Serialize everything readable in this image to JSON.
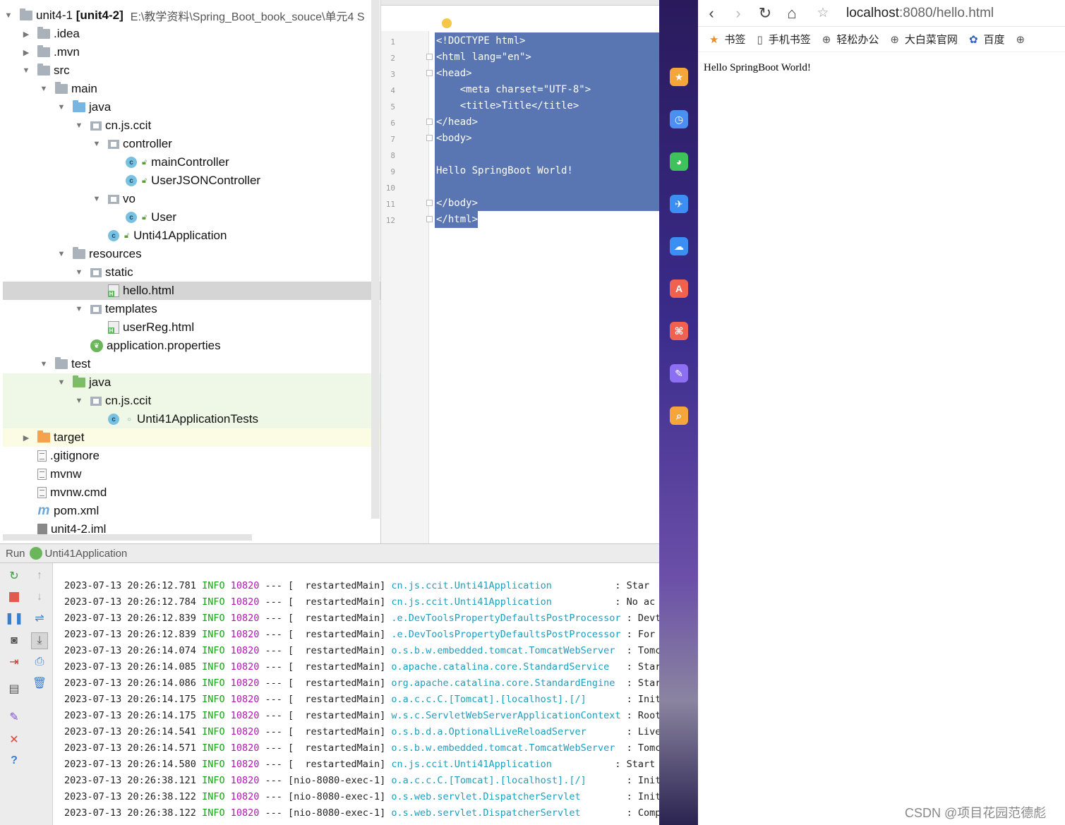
{
  "project": {
    "items": [
      {
        "label": "unit4-1",
        "bold": "[unit4-2]",
        "path": "E:\\教学资料\\Spring_Boot_book_souce\\单元4 S"
      },
      {
        "label": ".idea"
      },
      {
        "label": ".mvn"
      },
      {
        "label": "src"
      },
      {
        "label": "main"
      },
      {
        "label": "java"
      },
      {
        "label": "cn.js.ccit"
      },
      {
        "label": "controller"
      },
      {
        "label": "mainController"
      },
      {
        "label": "UserJSONController"
      },
      {
        "label": "vo"
      },
      {
        "label": "User"
      },
      {
        "label": "Unti41Application"
      },
      {
        "label": "resources"
      },
      {
        "label": "static"
      },
      {
        "label": "hello.html"
      },
      {
        "label": "templates"
      },
      {
        "label": "userReg.html"
      },
      {
        "label": "application.properties"
      },
      {
        "label": "test"
      },
      {
        "label": "java"
      },
      {
        "label": "cn.js.ccit"
      },
      {
        "label": "Unti41ApplicationTests"
      },
      {
        "label": "target"
      },
      {
        "label": ".gitignore"
      },
      {
        "label": "mvnw"
      },
      {
        "label": "mvnw.cmd"
      },
      {
        "label": "pom.xml"
      },
      {
        "label": "unit4-2.iml"
      }
    ]
  },
  "editor": {
    "lines": [
      {
        "n": "1",
        "text": "<!DOCTYPE html>"
      },
      {
        "n": "2",
        "text": "<html lang=\"en\">"
      },
      {
        "n": "3",
        "text": "<head>"
      },
      {
        "n": "4",
        "text": "    <meta charset=\"UTF-8\">"
      },
      {
        "n": "5",
        "text": "    <title>Title</title>"
      },
      {
        "n": "6",
        "text": "</head>"
      },
      {
        "n": "7",
        "text": "<body>"
      },
      {
        "n": "8",
        "text": ""
      },
      {
        "n": "9",
        "text": "Hello SpringBoot World!"
      },
      {
        "n": "10",
        "text": ""
      },
      {
        "n": "11",
        "text": "</body>"
      },
      {
        "n": "12",
        "text": "</html>"
      }
    ]
  },
  "run": {
    "tab_label": "Run",
    "app_name": "Unti41Application",
    "logs": [
      {
        "ts": "2023-07-13 20:26:12.781",
        "level": "INFO",
        "pid": "10820",
        "sep": "---",
        "thread": "[  restartedMain]",
        "logger": "cn.js.ccit.Unti41Application          ",
        "msg": ": Star"
      },
      {
        "ts": "2023-07-13 20:26:12.784",
        "level": "INFO",
        "pid": "10820",
        "sep": "---",
        "thread": "[  restartedMain]",
        "logger": "cn.js.ccit.Unti41Application          ",
        "msg": ": No ac"
      },
      {
        "ts": "2023-07-13 20:26:12.839",
        "level": "INFO",
        "pid": "10820",
        "sep": "---",
        "thread": "[  restartedMain]",
        "logger": ".e.DevToolsPropertyDefaultsPostProcessor",
        "msg": ": Devto"
      },
      {
        "ts": "2023-07-13 20:26:12.839",
        "level": "INFO",
        "pid": "10820",
        "sep": "---",
        "thread": "[  restartedMain]",
        "logger": ".e.DevToolsPropertyDefaultsPostProcessor",
        "msg": ": For a"
      },
      {
        "ts": "2023-07-13 20:26:14.074",
        "level": "INFO",
        "pid": "10820",
        "sep": "---",
        "thread": "[  restartedMain]",
        "logger": "o.s.b.w.embedded.tomcat.TomcatWebServer ",
        "msg": ": Tomca"
      },
      {
        "ts": "2023-07-13 20:26:14.085",
        "level": "INFO",
        "pid": "10820",
        "sep": "---",
        "thread": "[  restartedMain]",
        "logger": "o.apache.catalina.core.StandardService  ",
        "msg": ": Start"
      },
      {
        "ts": "2023-07-13 20:26:14.086",
        "level": "INFO",
        "pid": "10820",
        "sep": "---",
        "thread": "[  restartedMain]",
        "logger": "org.apache.catalina.core.StandardEngine ",
        "msg": ": Start"
      },
      {
        "ts": "2023-07-13 20:26:14.175",
        "level": "INFO",
        "pid": "10820",
        "sep": "---",
        "thread": "[  restartedMain]",
        "logger": "o.a.c.c.C.[Tomcat].[localhost].[/]      ",
        "msg": ": Initi"
      },
      {
        "ts": "2023-07-13 20:26:14.175",
        "level": "INFO",
        "pid": "10820",
        "sep": "---",
        "thread": "[  restartedMain]",
        "logger": "w.s.c.ServletWebServerApplicationContext",
        "msg": ": Root"
      },
      {
        "ts": "2023-07-13 20:26:14.541",
        "level": "INFO",
        "pid": "10820",
        "sep": "---",
        "thread": "[  restartedMain]",
        "logger": "o.s.b.d.a.OptionalLiveReloadServer      ",
        "msg": ": LiveR"
      },
      {
        "ts": "2023-07-13 20:26:14.571",
        "level": "INFO",
        "pid": "10820",
        "sep": "---",
        "thread": "[  restartedMain]",
        "logger": "o.s.b.w.embedded.tomcat.TomcatWebServer ",
        "msg": ": Tomca"
      },
      {
        "ts": "2023-07-13 20:26:14.580",
        "level": "INFO",
        "pid": "10820",
        "sep": "---",
        "thread": "[  restartedMain]",
        "logger": "cn.js.ccit.Unti41Application          ",
        "msg": ": Start"
      },
      {
        "ts": "2023-07-13 20:26:38.121",
        "level": "INFO",
        "pid": "10820",
        "sep": "---",
        "thread": "[nio-8080-exec-1]",
        "logger": "o.a.c.c.C.[Tomcat].[localhost].[/]      ",
        "msg": ": Initi"
      },
      {
        "ts": "2023-07-13 20:26:38.122",
        "level": "INFO",
        "pid": "10820",
        "sep": "---",
        "thread": "[nio-8080-exec-1]",
        "logger": "o.s.web.servlet.DispatcherServlet       ",
        "msg": ": Initi"
      },
      {
        "ts": "2023-07-13 20:26:38.122",
        "level": "INFO",
        "pid": "10820",
        "sep": "---",
        "thread": "[nio-8080-exec-1]",
        "logger": "o.s.web.servlet.DispatcherServlet       ",
        "msg": ": Compl"
      }
    ]
  },
  "browser": {
    "url_host": "localhost",
    "url_rest": ":8080/hello.html",
    "bookmarks": [
      "书签",
      "手机书签",
      "轻松办公",
      "大白菜官网",
      "百度"
    ],
    "content": "Hello SpringBoot World!"
  },
  "watermark": "CSDN @项目花园范德彪",
  "colors": {
    "selection": "#5a76b2",
    "log_level": "#16a016",
    "log_pid": "#b512b5",
    "log_logger": "#1ba0c0"
  }
}
